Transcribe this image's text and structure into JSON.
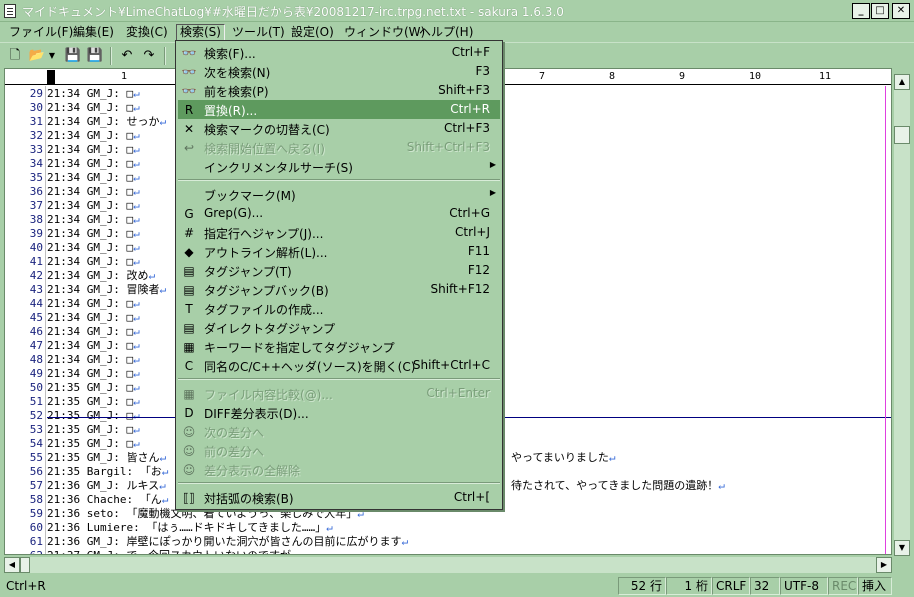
{
  "window": {
    "title": "マイドキュメント¥LimeChatLog¥#水曜日だから表¥20081217-irc.trpg.net.txt - sakura 1.6.3.0",
    "min": "_",
    "max": "□",
    "close": "✕"
  },
  "menubar": [
    "ファイル(F)",
    "編集(E)",
    "変換(C)",
    "検索(S)",
    "ツール(T)",
    "設定(O)",
    "ウィンドウ(W)",
    "ヘルプ(H)"
  ],
  "ruler": {
    "marks": [
      "1",
      "7",
      "8",
      "9",
      "10",
      "11"
    ]
  },
  "editor": {
    "line_numbers": [
      "29",
      "30",
      "31",
      "32",
      "33",
      "34",
      "35",
      "36",
      "37",
      "38",
      "39",
      "40",
      "41",
      "42",
      "43",
      "44",
      "45",
      "46",
      "47",
      "48",
      "49",
      "50",
      "51",
      "52",
      "53",
      "54",
      "55",
      "56",
      "57",
      "58",
      "59",
      "60",
      "61",
      "62"
    ],
    "lines": [
      "21:34 GM_J: □",
      "21:34 GM_J: □",
      "21:34 GM_J: せっか",
      "21:34 GM_J: □",
      "21:34 GM_J: □",
      "21:34 GM_J: □",
      "21:34 GM_J: □",
      "21:34 GM_J: □",
      "21:34 GM_J: □",
      "21:34 GM_J: □",
      "21:34 GM_J: □",
      "21:34 GM_J: □",
      "21:34 GM_J: □",
      "21:34 GM_J: 改め",
      "21:34 GM_J: 冒険者",
      "21:34 GM_J: □",
      "21:34 GM_J: □",
      "21:34 GM_J: □",
      "21:34 GM_J: □",
      "21:34 GM_J: □",
      "21:34 GM_J: □",
      "21:35 GM_J: □",
      "21:35 GM_J: □",
      "21:35 GM_J: □",
      "21:35 GM_J: □",
      "21:35 GM_J: □",
      "21:35 GM_J: 皆さん",
      "21:35 Bargil: 「お",
      "21:36 GM_J: ルキス",
      "21:36 Chache: 「ん",
      "21:36 seto: 「魔動機文明、着ていようっ、楽しみで大年」",
      "21:36 Lumiere: 「はぅ……ドキドキしてきました……」",
      "21:36 GM_J: 岸壁にぽっかり開いた洞穴が皆さんの目前に広がります",
      "21:37 GM_J: で、今回スカウトいないのですが"
    ],
    "tail_55": "やってまいりました",
    "tail_57": "待たされて、やってきました問題の遺跡！",
    "eol": "↵"
  },
  "search_menu": {
    "items": [
      {
        "icon": "binoculars-icon",
        "glyph": "👓",
        "label": "検索(F)...",
        "shortcut": "Ctrl+F"
      },
      {
        "icon": "find-next-icon",
        "glyph": "👓",
        "label": "次を検索(N)",
        "shortcut": "F3"
      },
      {
        "icon": "find-prev-icon",
        "glyph": "👓",
        "label": "前を検索(P)",
        "shortcut": "Shift+F3"
      },
      {
        "icon": "replace-icon",
        "glyph": "R",
        "label": "置換(R)...",
        "shortcut": "Ctrl+R"
      },
      {
        "icon": "clear-mark-icon",
        "glyph": "✕",
        "label": "検索マークの切替え(C)",
        "shortcut": "Ctrl+F3"
      },
      {
        "icon": "back-to-start-icon",
        "glyph": "↩",
        "label": "検索開始位置へ戻る(I)",
        "shortcut": "Shift+Ctrl+F3"
      },
      {
        "icon": "",
        "glyph": "",
        "label": "インクリメンタルサーチ(S)",
        "shortcut": ""
      },
      {
        "icon": "",
        "glyph": "",
        "label": "ブックマーク(M)",
        "shortcut": ""
      },
      {
        "icon": "grep-icon",
        "glyph": "G",
        "label": "Grep(G)...",
        "shortcut": "Ctrl+G"
      },
      {
        "icon": "jump-line-icon",
        "glyph": "#",
        "label": "指定行へジャンプ(J)...",
        "shortcut": "Ctrl+J"
      },
      {
        "icon": "outline-icon",
        "glyph": "◆",
        "label": "アウトライン解析(L)...",
        "shortcut": "F11"
      },
      {
        "icon": "tag-jump-icon",
        "glyph": "▤",
        "label": "タグジャンプ(T)",
        "shortcut": "F12"
      },
      {
        "icon": "tag-jump-back-icon",
        "glyph": "▤",
        "label": "タグジャンプバック(B)",
        "shortcut": "Shift+F12"
      },
      {
        "icon": "tag-file-icon",
        "glyph": "T",
        "label": "タグファイルの作成...",
        "shortcut": ""
      },
      {
        "icon": "direct-tag-icon",
        "glyph": "▤",
        "label": "ダイレクトタグジャンプ",
        "shortcut": ""
      },
      {
        "icon": "keyword-tag-icon",
        "glyph": "▦",
        "label": "キーワードを指定してタグジャンプ",
        "shortcut": ""
      },
      {
        "icon": "open-header-icon",
        "glyph": "C",
        "label": "同名のC/C++ヘッダ(ソース)を開く(C)",
        "shortcut": "Shift+Ctrl+C"
      },
      {
        "icon": "compare-icon",
        "glyph": "▦",
        "label": "ファイル内容比較(@)...",
        "shortcut": "Ctrl+Enter"
      },
      {
        "icon": "diff-icon",
        "glyph": "D",
        "label": "DIFF差分表示(D)...",
        "shortcut": ""
      },
      {
        "icon": "next-diff-icon",
        "glyph": "☺",
        "label": "次の差分へ",
        "shortcut": ""
      },
      {
        "icon": "prev-diff-icon",
        "glyph": "☺",
        "label": "前の差分へ",
        "shortcut": ""
      },
      {
        "icon": "clear-diff-icon",
        "glyph": "☺",
        "label": "差分表示の全解除",
        "shortcut": ""
      },
      {
        "icon": "bracket-icon",
        "glyph": "⟦⟧",
        "label": "対括弧の検索(B)",
        "shortcut": "Ctrl+["
      }
    ]
  },
  "status": {
    "left": "Ctrl+R",
    "line": "52 行",
    "col": "1 桁",
    "eol": "CRLF",
    "tab": "32",
    "encoding": "UTF-8",
    "rec": "REC",
    "mode": "挿入"
  }
}
